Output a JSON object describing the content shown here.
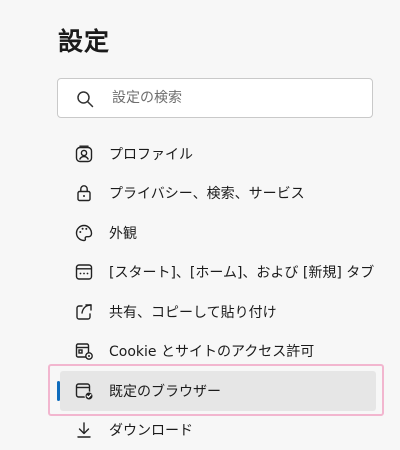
{
  "header": {
    "title": "設定"
  },
  "search": {
    "placeholder": "設定の検索",
    "value": "",
    "icon": "search-icon"
  },
  "nav": {
    "items": [
      {
        "label": "プロファイル",
        "icon": "profile-icon"
      },
      {
        "label": "プライバシー、検索、サービス",
        "icon": "lock-icon"
      },
      {
        "label": "外観",
        "icon": "palette-icon"
      },
      {
        "label": "[スタート]、[ホーム]、および [新規] タブ",
        "icon": "home-tabs-icon"
      },
      {
        "label": "共有、コピーして貼り付け",
        "icon": "share-icon"
      },
      {
        "label": "Cookie とサイトのアクセス許可",
        "icon": "site-permissions-icon"
      },
      {
        "label": "既定のブラウザー",
        "icon": "default-browser-icon",
        "selected": true
      },
      {
        "label": "ダウンロード",
        "icon": "download-icon"
      }
    ]
  },
  "colors": {
    "accent": "#0f6cbd",
    "selected_background": "#e6e6e6",
    "highlight_border": "#f2b6cf",
    "page_background": "#f7f7f7"
  }
}
